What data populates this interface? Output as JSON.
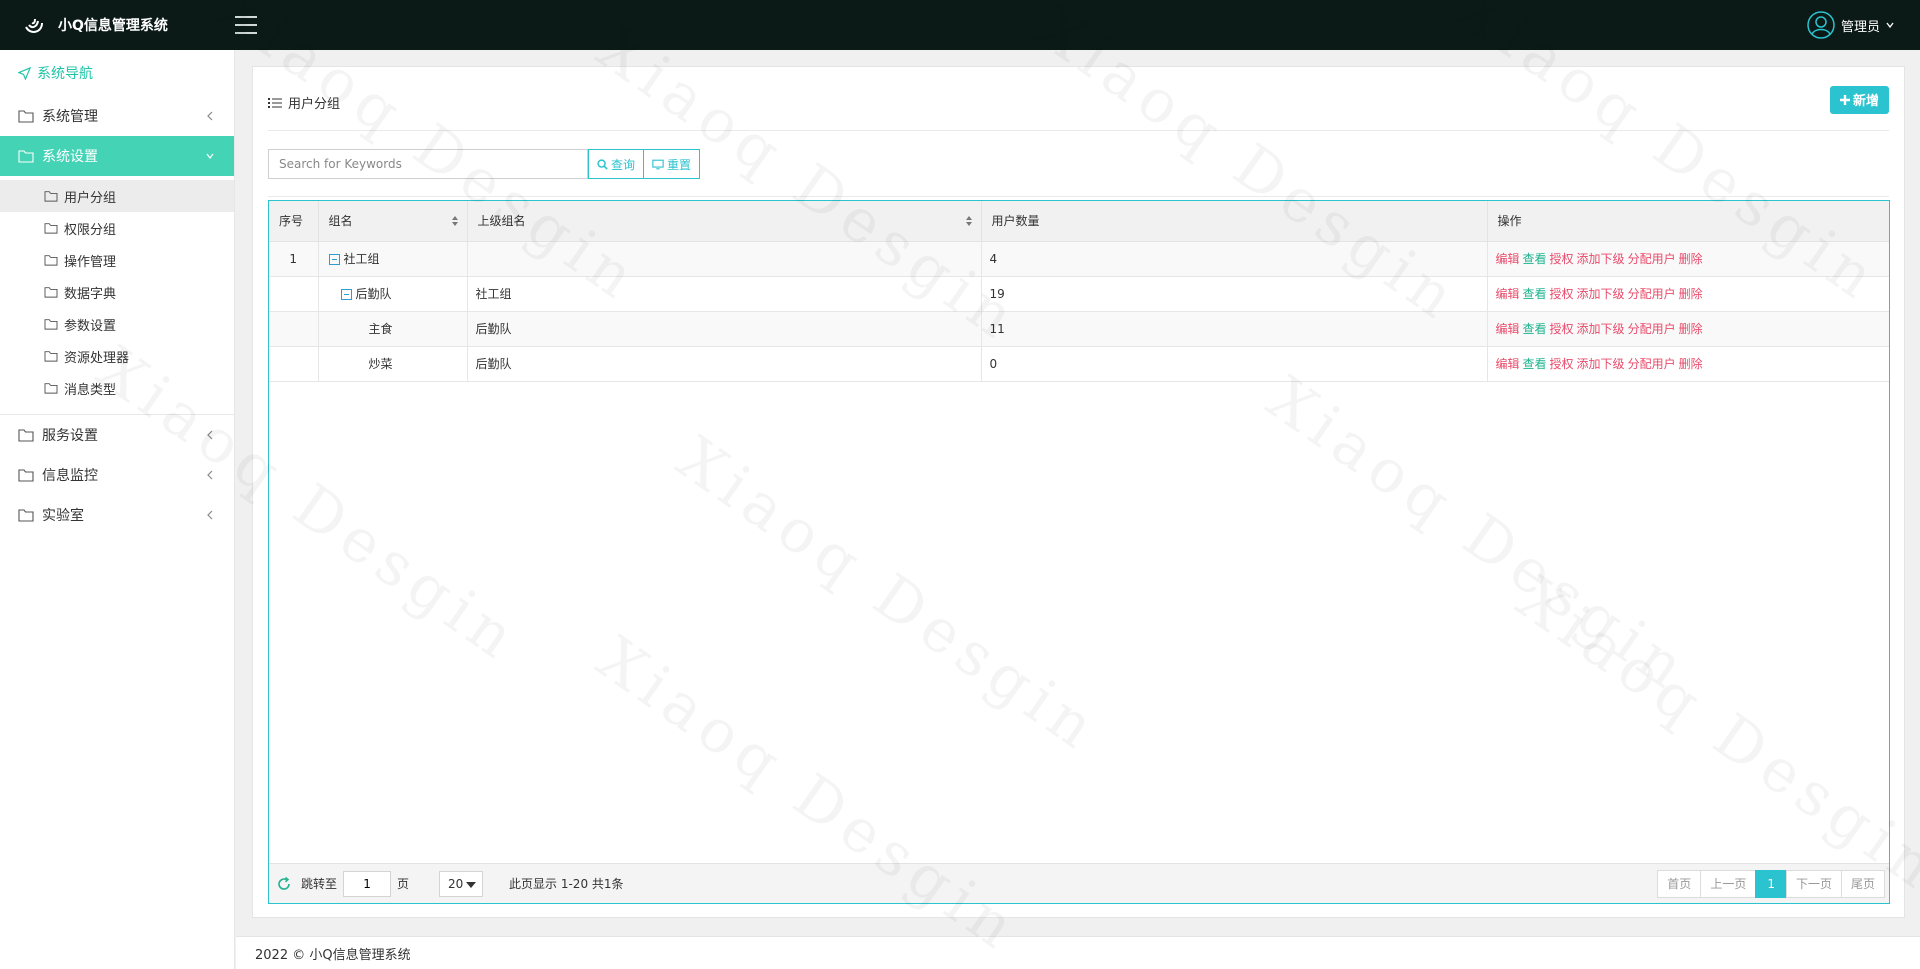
{
  "header": {
    "app_title": "小Q信息管理系统",
    "user_name": "管理员"
  },
  "sidebar": {
    "nav_title": "系统导航",
    "items": [
      {
        "label": "系统管理"
      },
      {
        "label": "系统设置"
      },
      {
        "label": "服务设置"
      },
      {
        "label": "信息监控"
      },
      {
        "label": "实验室"
      }
    ],
    "sub_items": [
      {
        "label": "用户分组"
      },
      {
        "label": "权限分组"
      },
      {
        "label": "操作管理"
      },
      {
        "label": "数据字典"
      },
      {
        "label": "参数设置"
      },
      {
        "label": "资源处理器"
      },
      {
        "label": "消息类型"
      }
    ]
  },
  "main": {
    "title": "用户分组",
    "add_label": "新增",
    "search_placeholder": "Search for Keywords",
    "query_label": "查询",
    "reset_label": "重置"
  },
  "table": {
    "columns": [
      "序号",
      "组名",
      "上级组名",
      "用户数量",
      "操作"
    ],
    "rows": [
      {
        "index": "1",
        "name": "社工组",
        "parent": "",
        "count": "4"
      },
      {
        "index": "",
        "name": "后勤队",
        "parent": "社工组",
        "count": "19"
      },
      {
        "index": "",
        "name": "主食",
        "parent": "后勤队",
        "count": "11"
      },
      {
        "index": "",
        "name": "炒菜",
        "parent": "后勤队",
        "count": "0"
      }
    ],
    "actions": {
      "edit": "编辑",
      "view": "查看",
      "auth": "授权",
      "add_child": "添加下级",
      "assign_user": "分配用户",
      "delete": "删除"
    }
  },
  "pager": {
    "jump_label": "跳转至",
    "page_value": "1",
    "page_unit": "页",
    "page_size": "20",
    "info": "此页显示 1-20 共1条",
    "first": "首页",
    "prev": "上一页",
    "current": "1",
    "next": "下一页",
    "last": "尾页"
  },
  "footer": {
    "text": "2022 © 小Q信息管理系统"
  },
  "watermark": {
    "text": "Xiaoq Desgin"
  },
  "colors": {
    "topbar": "#0b1a17",
    "accent": "#2bc3cf",
    "active_nav": "#45d3b6",
    "action_red": "#e94b6b",
    "action_green": "#1fb38e"
  }
}
